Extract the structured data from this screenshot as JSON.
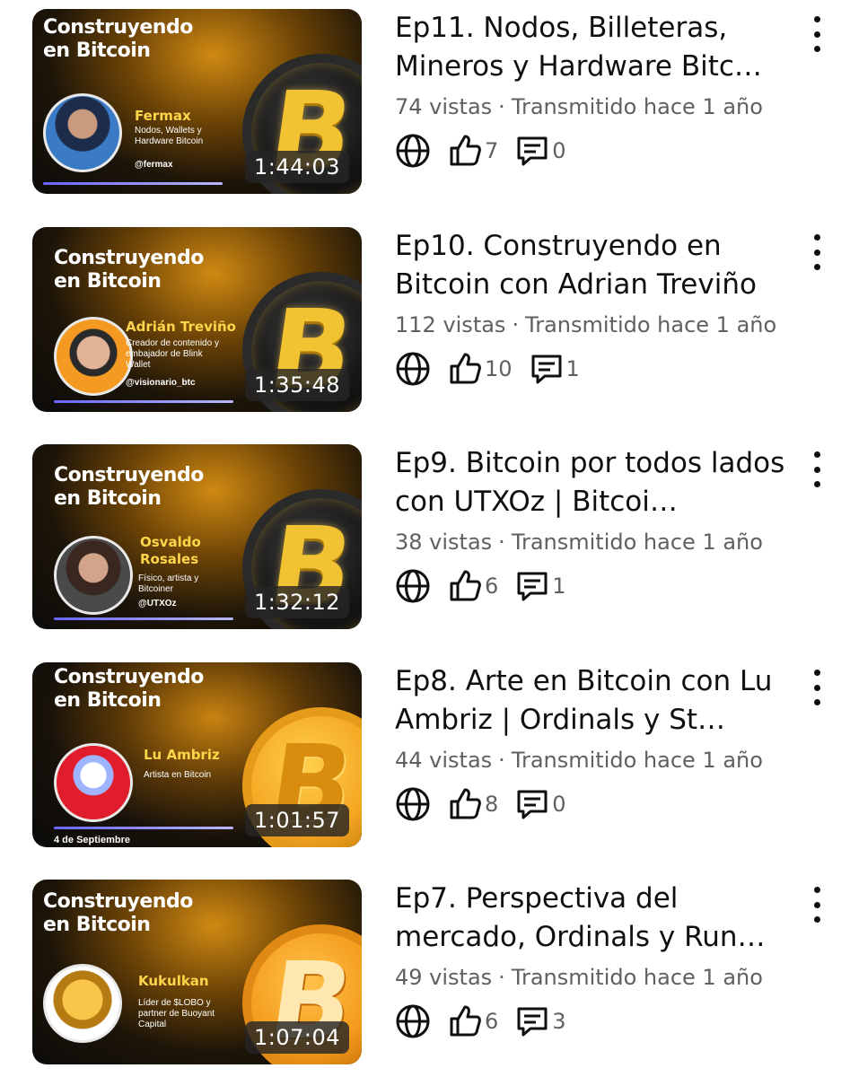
{
  "videos": [
    {
      "thumb": {
        "show_title": "Construyendo en Bitcoin",
        "guest": "Fermax",
        "desc": "Nodos, Wallets y Hardware Bitcoin",
        "handle": "@fermax",
        "duration": "1:44:03",
        "date": ""
      },
      "title": "Ep11. Nodos, Billeteras, Mineros y Hardware Bitc…",
      "views": "74 vistas",
      "separator": "·",
      "streamed": "Transmitido hace 1 año",
      "likes": "7",
      "comments": "0"
    },
    {
      "thumb": {
        "show_title": "Construyendo en Bitcoin",
        "guest": "Adrián Treviño",
        "desc": "Creador de contenido y embajador de Blink Wallet",
        "handle": "@visionario_btc",
        "duration": "1:35:48",
        "date": ""
      },
      "title": "Ep10. Construyendo en Bitcoin con Adrian Treviño",
      "views": "112 vistas",
      "separator": "·",
      "streamed": "Transmitido hace 1 año",
      "likes": "10",
      "comments": "1"
    },
    {
      "thumb": {
        "show_title": "Construyendo en Bitcoin",
        "guest": "Osvaldo Rosales",
        "desc": "Físico, artista y Bitcoiner",
        "handle": "@UTXOz",
        "duration": "1:32:12",
        "date": ""
      },
      "title": "Ep9. Bitcoin por todos lados con UTXOz | Bitcoi…",
      "views": "38 vistas",
      "separator": "·",
      "streamed": "Transmitido hace 1 año",
      "likes": "6",
      "comments": "1"
    },
    {
      "thumb": {
        "show_title": "Construyendo en Bitcoin",
        "guest": "Lu Ambriz",
        "desc": "Artista en Bitcoin",
        "handle": "",
        "duration": "1:01:57",
        "date": "4 de Septiembre"
      },
      "title": "Ep8. Arte en Bitcoin con Lu Ambriz | Ordinals y St…",
      "views": "44 vistas",
      "separator": "·",
      "streamed": "Transmitido hace 1 año",
      "likes": "8",
      "comments": "0"
    },
    {
      "thumb": {
        "show_title": "Construyendo en Bitcoin",
        "guest": "Kukulkan",
        "desc": "Líder de $LOBO y partner de Buoyant Capital",
        "handle": "",
        "duration": "1:07:04",
        "date": ""
      },
      "title": "Ep7. Perspectiva del mercado, Ordinals y Run…",
      "views": "49 vistas",
      "separator": "·",
      "streamed": "Transmitido hace 1 año",
      "likes": "6",
      "comments": "3"
    }
  ],
  "icons": {
    "visibility": "globe-icon",
    "likes": "thumbs-up-icon",
    "comments": "comment-icon",
    "menu": "more-vertical-icon",
    "coin": "bitcoin-coin"
  },
  "colors": {
    "text": "#0f0f0f",
    "secondary": "#606060",
    "accent": "#ffd54a"
  }
}
